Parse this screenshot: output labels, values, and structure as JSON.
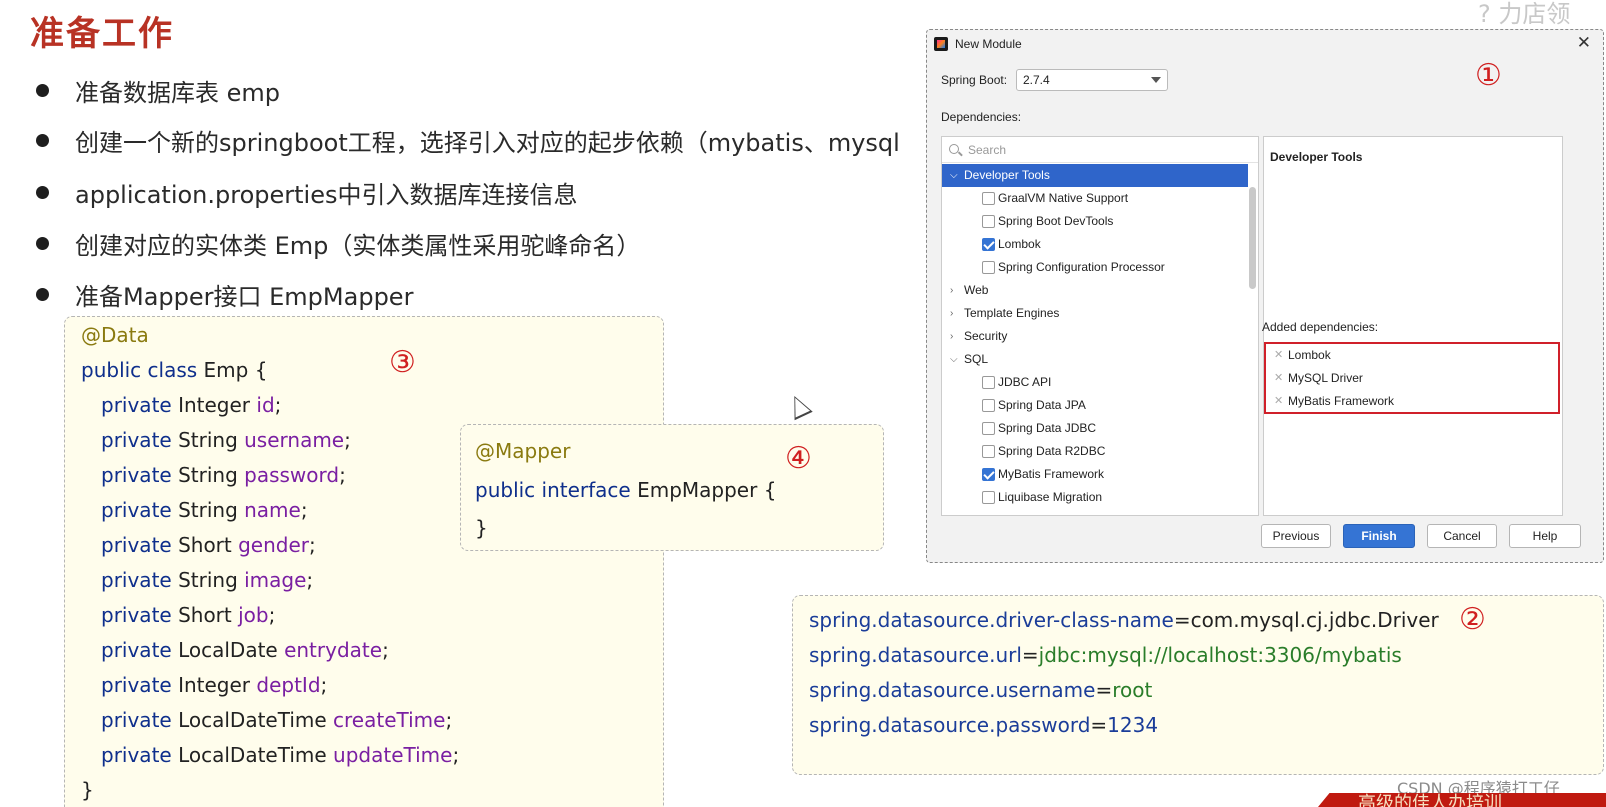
{
  "slide": {
    "title": "准备工作",
    "bullets": [
      "准备数据库表 emp",
      "创建一个新的springboot工程，选择引入对应的起步依赖（mybatis、mysql",
      "application.properties中引入数据库连接信息",
      "创建对应的实体类 Emp（实体类属性采用驼峰命名）",
      "准备Mapper接口 EmpMapper"
    ],
    "top_corner_text": "? 力店领",
    "watermark": "CSDN @程序猿打工仔",
    "banner_text": "高级的佳人办培训"
  },
  "step_markers": {
    "one": "①",
    "two": "②",
    "three": "③",
    "four": "④"
  },
  "entity_code": {
    "annotation": "@Data",
    "decl_kw": "public class",
    "decl_name": "Emp {",
    "fields": [
      {
        "kw": "private",
        "type": "Integer",
        "name": "id"
      },
      {
        "kw": "private",
        "type": "String",
        "name": "username"
      },
      {
        "kw": "private",
        "type": "String",
        "name": "password"
      },
      {
        "kw": "private",
        "type": "String",
        "name": "name"
      },
      {
        "kw": "private",
        "type": "Short",
        "name": "gender"
      },
      {
        "kw": "private",
        "type": "String",
        "name": "image"
      },
      {
        "kw": "private",
        "type": "Short",
        "name": "job"
      },
      {
        "kw": "private",
        "type": "LocalDate",
        "name": "entrydate"
      },
      {
        "kw": "private",
        "type": "Integer",
        "name": "deptId"
      },
      {
        "kw": "private",
        "type": "LocalDateTime",
        "name": "createTime"
      },
      {
        "kw": "private",
        "type": "LocalDateTime",
        "name": "updateTime"
      }
    ],
    "semicolon": ";",
    "closing": "}"
  },
  "mapper_code": {
    "annotation": "@Mapper",
    "decl_kw": "public interface",
    "decl_name": "EmpMapper {",
    "closing": "}"
  },
  "properties_code": {
    "lines": [
      {
        "key": "spring.datasource.driver-class-name",
        "eq": "=",
        "value": "com.mysql.cj.jdbc.Driver",
        "style": "plain"
      },
      {
        "key": "spring.datasource.url",
        "eq": "=",
        "value": "jdbc:mysql://localhost:3306/mybatis",
        "style": "strv"
      },
      {
        "key": "spring.datasource.username",
        "eq": "=",
        "value": "root",
        "style": "strv"
      },
      {
        "key": "spring.datasource.password",
        "eq": "=",
        "value": "1234",
        "style": "numv"
      }
    ]
  },
  "dialog": {
    "title": "New Module",
    "close_glyph": "✕",
    "spring_boot_label": "Spring Boot:",
    "spring_boot_value": "2.7.4",
    "dependencies_label": "Dependencies:",
    "search_placeholder": "Search",
    "tree": [
      {
        "type": "category",
        "label": "Developer Tools",
        "expanded": true,
        "selected": true
      },
      {
        "type": "item",
        "label": "GraalVM Native Support",
        "checked": false
      },
      {
        "type": "item",
        "label": "Spring Boot DevTools",
        "checked": false
      },
      {
        "type": "item",
        "label": "Lombok",
        "checked": true
      },
      {
        "type": "item",
        "label": "Spring Configuration Processor",
        "checked": false
      },
      {
        "type": "category",
        "label": "Web",
        "expanded": false,
        "selected": false
      },
      {
        "type": "category",
        "label": "Template Engines",
        "expanded": false,
        "selected": false
      },
      {
        "type": "category",
        "label": "Security",
        "expanded": false,
        "selected": false
      },
      {
        "type": "category",
        "label": "SQL",
        "expanded": true,
        "selected": false
      },
      {
        "type": "item",
        "label": "JDBC API",
        "checked": false
      },
      {
        "type": "item",
        "label": "Spring Data JPA",
        "checked": false
      },
      {
        "type": "item",
        "label": "Spring Data JDBC",
        "checked": false
      },
      {
        "type": "item",
        "label": "Spring Data R2DBC",
        "checked": false
      },
      {
        "type": "item",
        "label": "MyBatis Framework",
        "checked": true
      },
      {
        "type": "item",
        "label": "Liquibase Migration",
        "checked": false
      }
    ],
    "info_title": "Developer Tools",
    "added_label": "Added dependencies:",
    "added": [
      "Lombok",
      "MySQL Driver",
      "MyBatis Framework"
    ],
    "remove_glyph": "✕",
    "buttons": {
      "previous": "Previous",
      "finish": "Finish",
      "cancel": "Cancel",
      "help": "Help"
    }
  },
  "colors": {
    "title_red": "#b83224",
    "code_bg": "#fffdec",
    "keyword": "#0f2f8c",
    "annotation": "#8a7a10",
    "field": "#7a1fa2",
    "string_value": "#2a7d2a",
    "selection_blue": "#2f65ca",
    "highlight_red": "#d0202a"
  }
}
